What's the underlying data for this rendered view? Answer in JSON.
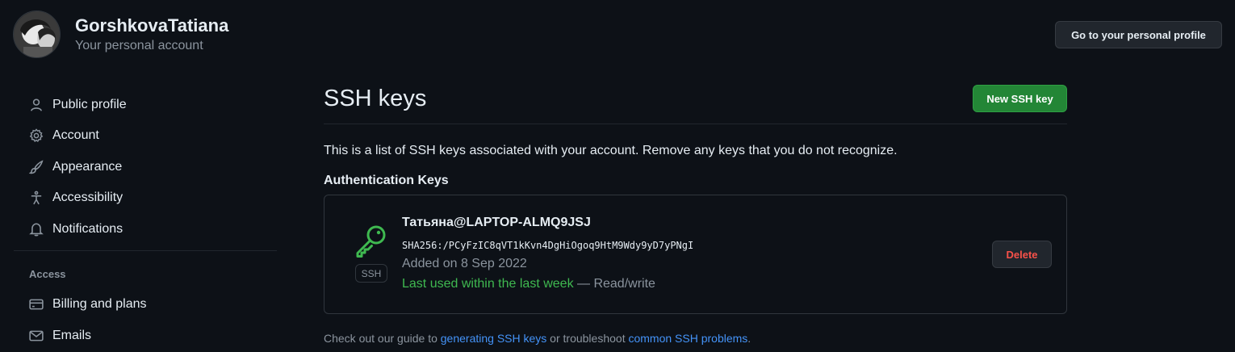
{
  "header": {
    "username": "GorshkovaTatiana",
    "subtitle": "Your personal account",
    "profile_button": "Go to your personal profile"
  },
  "sidebar": {
    "items": [
      {
        "label": "Public profile",
        "icon": "person-icon"
      },
      {
        "label": "Account",
        "icon": "gear-icon"
      },
      {
        "label": "Appearance",
        "icon": "paintbrush-icon"
      },
      {
        "label": "Accessibility",
        "icon": "accessibility-icon"
      },
      {
        "label": "Notifications",
        "icon": "bell-icon"
      }
    ],
    "access_heading": "Access",
    "access_items": [
      {
        "label": "Billing and plans",
        "icon": "credit-card-icon"
      },
      {
        "label": "Emails",
        "icon": "mail-icon"
      }
    ]
  },
  "main": {
    "title": "SSH keys",
    "new_key_button": "New SSH key",
    "intro": "This is a list of SSH keys associated with your account. Remove any keys that you do not recognize.",
    "auth_heading": "Authentication Keys",
    "key": {
      "icon": "key-icon",
      "badge": "SSH",
      "title": "Татьяна@LAPTOP-ALMQ9JSJ",
      "fingerprint": "SHA256:/PCyFzIC8qVT1kKvn4DgHiOgoq9HtM9Wdy9yD7yPNgI",
      "added": "Added on 8 Sep 2022",
      "last_used": "Last used within the last week",
      "access": " — Read/write",
      "delete_button": "Delete"
    },
    "guide": {
      "prefix": "Check out our guide to ",
      "link1": "generating SSH keys",
      "middle": " or troubleshoot ",
      "link2": "common SSH problems",
      "suffix": "."
    }
  },
  "colors": {
    "background": "#0d1117",
    "primary_button": "#238636",
    "success_text": "#3fb950",
    "danger_text": "#f85149",
    "link": "#4493f8",
    "muted_text": "#8b949e"
  }
}
